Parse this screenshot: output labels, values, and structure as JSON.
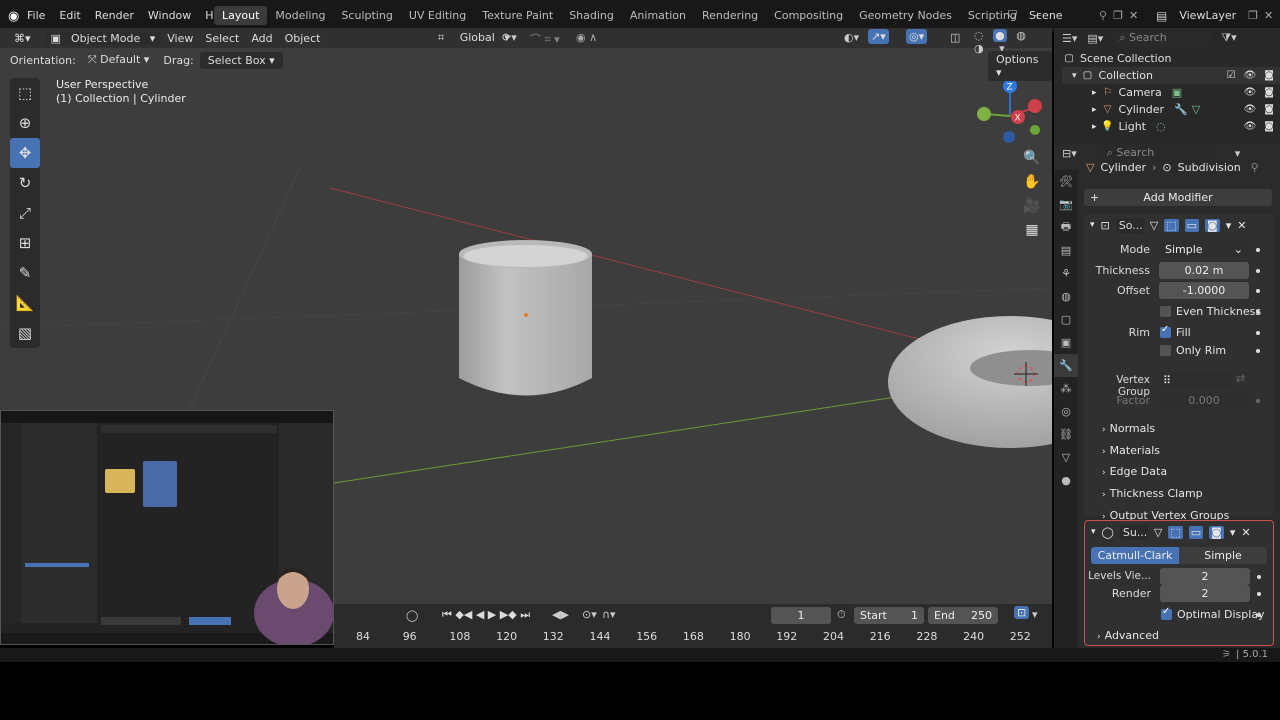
{
  "topbar": {
    "menu": [
      "File",
      "Edit",
      "Render",
      "Window",
      "Help"
    ],
    "workspaces": [
      "Layout",
      "Modeling",
      "Sculpting",
      "UV Editing",
      "Texture Paint",
      "Shading",
      "Animation",
      "Rendering",
      "Compositing",
      "Geometry Nodes",
      "Scripting"
    ],
    "active_workspace": "Layout",
    "scene": "Scene",
    "view_layer": "ViewLayer"
  },
  "viewport": {
    "mode": "Object Mode",
    "menus": [
      "View",
      "Select",
      "Add",
      "Object"
    ],
    "transform_orientation": "Global",
    "orientation_label": "Orientation:",
    "orientation_value": "Default",
    "drag_label": "Drag:",
    "drag_value": "Select Box",
    "options": "Options",
    "view_name": "User Perspective",
    "collection_info_a": "(1) Collection",
    "collection_info_b": "Cylinder"
  },
  "outliner": {
    "search_placeholder": "Search",
    "scene_collection": "Scene Collection",
    "collection": "Collection",
    "items": [
      "Camera",
      "Cylinder",
      "Light"
    ]
  },
  "properties": {
    "search_placeholder": "Search",
    "breadcrumb_object": "Cylinder",
    "breadcrumb_modifier": "Subdivision",
    "add_modifier": "Add Modifier",
    "solidify": {
      "short_name": "So...",
      "mode_label": "Mode",
      "mode_value": "Simple",
      "thickness_label": "Thickness",
      "thickness_value": "0.02 m",
      "offset_label": "Offset",
      "offset_value": "-1.0000",
      "even_thickness": "Even Thickness",
      "rim_label": "Rim",
      "fill": "Fill",
      "only_rim": "Only Rim",
      "vertex_group_label": "Vertex Group",
      "factor_label": "Factor",
      "factor_value": "0.000",
      "subpanels": [
        "Normals",
        "Materials",
        "Edge Data",
        "Thickness Clamp",
        "Output Vertex Groups"
      ]
    },
    "subdivision": {
      "short_name": "Su...",
      "catmull": "Catmull-Clark",
      "simple": "Simple",
      "levels_label": "Levels Vie...",
      "levels_value": "2",
      "render_label": "Render",
      "render_value": "2",
      "optimal_display": "Optimal Display",
      "advanced": "Advanced"
    }
  },
  "timeline": {
    "current_frame": "1",
    "start_label": "Start",
    "start_value": "1",
    "end_label": "End",
    "end_value": "250",
    "ticks": [
      "84",
      "96",
      "108",
      "120",
      "132",
      "144",
      "156",
      "168",
      "180",
      "192",
      "204",
      "216",
      "228",
      "240",
      "252"
    ]
  },
  "status": {
    "version": "5.0.1"
  },
  "colors": {
    "accent": "#4772b3",
    "background": "#3d3d3d",
    "x_axis": "#9a3d45",
    "y_axis": "#6f9a3a"
  }
}
